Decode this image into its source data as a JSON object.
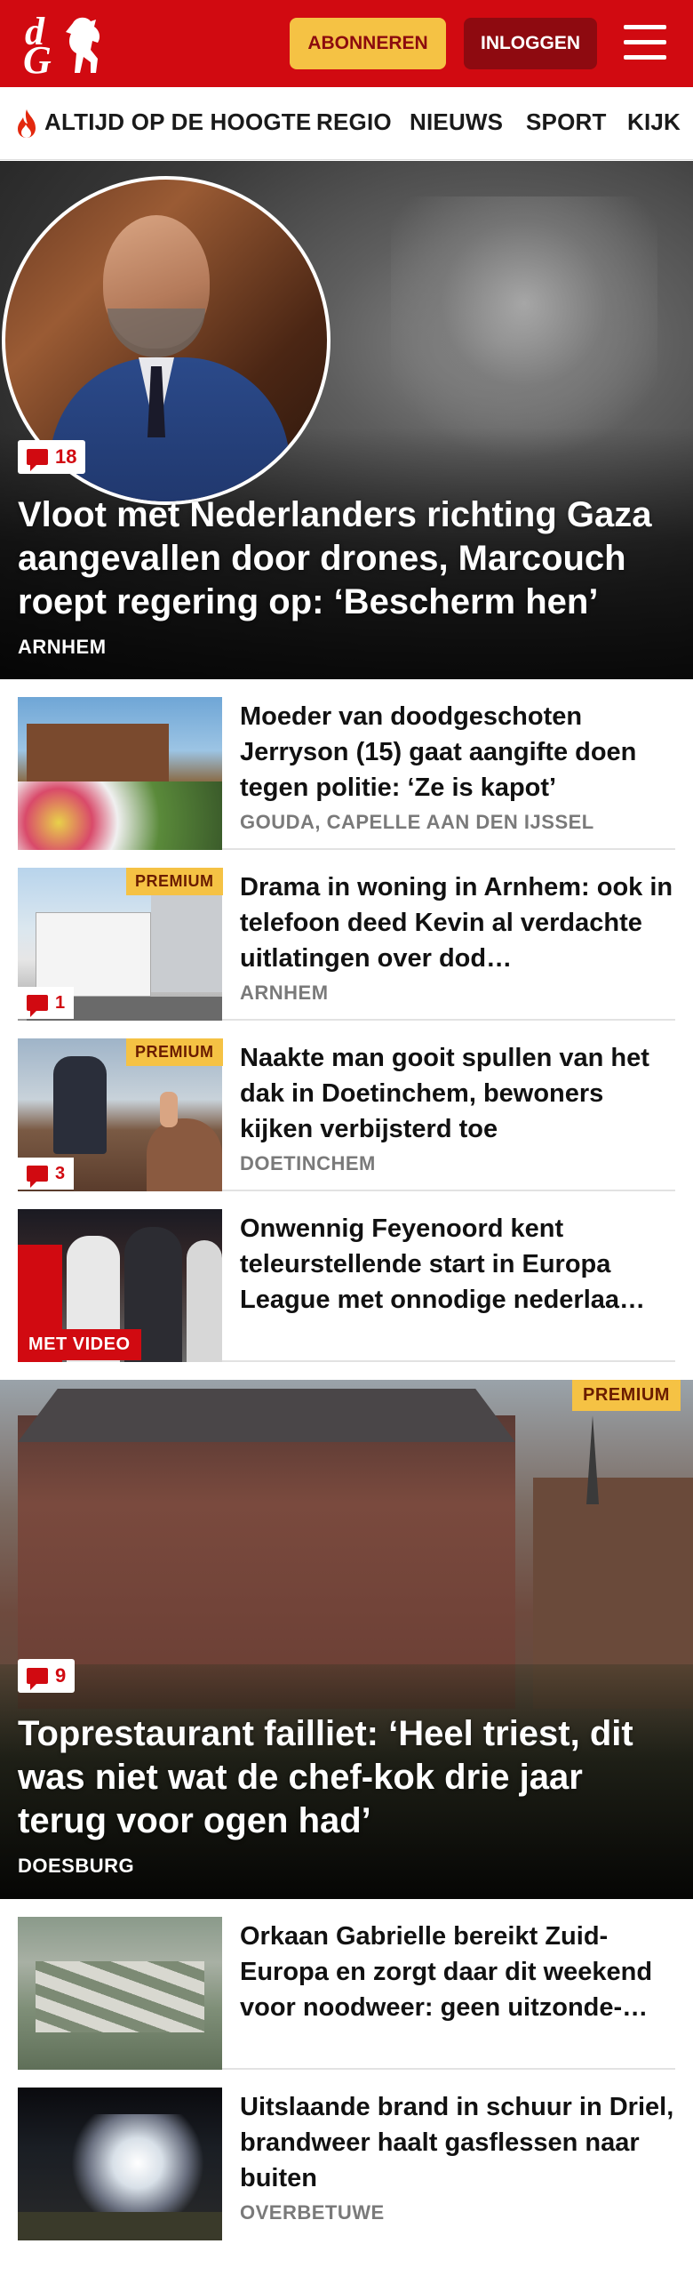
{
  "header": {
    "logo_letters": [
      "d",
      "G"
    ],
    "subscribe_label": "ABONNEREN",
    "login_label": "INLOGGEN",
    "brand_color": "#d10a11",
    "subscribe_color": "#f5c244",
    "login_color": "#8e0a10"
  },
  "nav": {
    "items": [
      "ALTIJD OP DE HOOGTE",
      "REGIO",
      "NIEUWS",
      "SPORT",
      "KIJK"
    ],
    "icon": "flame-icon"
  },
  "hero1": {
    "comments": "18",
    "title": "Vloot met Nederlanders richting Gaza aangevallen door drones, Marcouch roept regering op: ‘Bescherm hen’",
    "location": "ARNHEM"
  },
  "articles": [
    {
      "title": "Moeder van doodgeschoten Jerryson (15) gaat aangifte doen tegen politie: ‘Ze is kapot’",
      "location": "GOUDA, CAPELLE AAN DEN IJSSEL"
    },
    {
      "title": "Drama in woning in Arnhem: ook in telefoon deed Kevin al verdachte uitlatingen over dod…",
      "location": "ARNHEM",
      "premium": "PREMIUM",
      "comments": "1"
    },
    {
      "title": "Naakte man gooit spullen van het dak in Doetinchem, bewoners kijken verbijsterd toe",
      "location": "DOETINCHEM",
      "premium": "PREMIUM",
      "comments": "3"
    },
    {
      "title": "Onwennig Feyenoord kent teleurstellende start in Europa League met onnodige nederlaa…",
      "video": "MET VIDEO"
    }
  ],
  "hero2": {
    "premium": "PREMIUM",
    "comments": "9",
    "title": "Toprestaurant failliet: ‘Heel triest, dit was niet wat de chef-kok drie jaar terug voor ogen had’",
    "location": "DOESBURG"
  },
  "articles2": [
    {
      "title": "Orkaan Gabrielle bereikt Zuid-Europa en zorgt daar dit weekend voor noodweer: geen uitzonde-…"
    },
    {
      "title": "Uitslaande brand in schuur in Driel, brandweer haalt gasflessen naar buiten",
      "location": "OVERBETUWE"
    }
  ]
}
